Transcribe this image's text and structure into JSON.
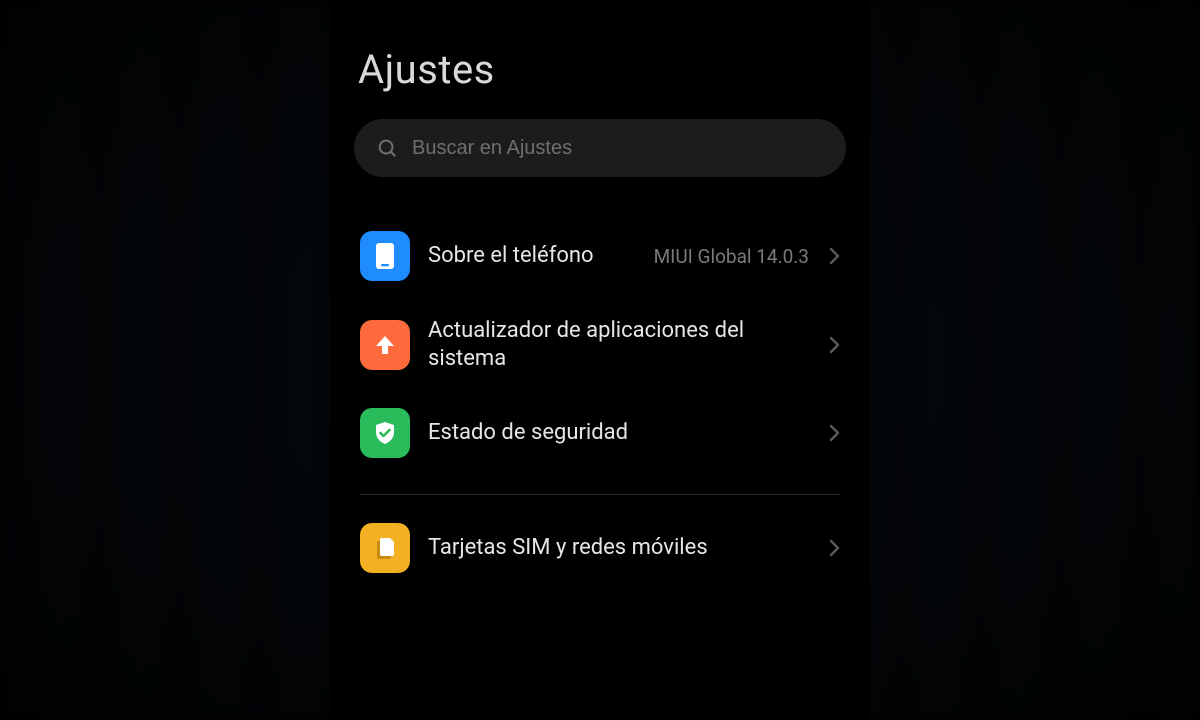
{
  "header": {
    "title": "Ajustes"
  },
  "search": {
    "placeholder": "Buscar en Ajustes"
  },
  "rows": {
    "about": {
      "label": "Sobre el teléfono",
      "value": "MIUI Global 14.0.3"
    },
    "updater": {
      "label": "Actualizador de aplicaciones del sistema"
    },
    "security": {
      "label": "Estado de seguridad"
    },
    "sim": {
      "label": "Tarjetas SIM y redes móviles"
    }
  }
}
